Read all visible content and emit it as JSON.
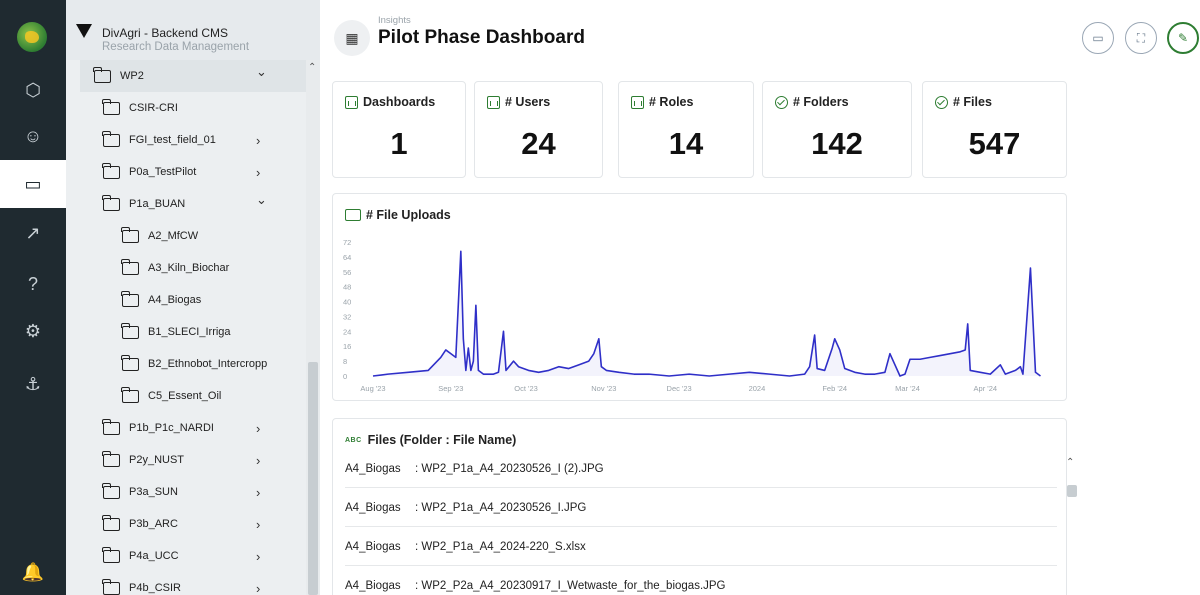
{
  "rail": {
    "items": [
      {
        "icon": "cube-icon",
        "glyph": "⬡",
        "active": false
      },
      {
        "icon": "users-icon",
        "glyph": "☺",
        "active": false
      },
      {
        "icon": "folder-icon",
        "glyph": "▭",
        "active": true
      },
      {
        "icon": "trend-icon",
        "glyph": "↗",
        "active": false
      },
      {
        "icon": "help-icon",
        "glyph": "?",
        "active": false
      },
      {
        "icon": "gear-icon",
        "glyph": "⚙",
        "active": false
      },
      {
        "icon": "anchor-icon",
        "glyph": "⚓",
        "active": false
      },
      {
        "icon": "bell-icon",
        "glyph": "🔔",
        "active": false
      }
    ]
  },
  "sidebar": {
    "title": "DivAgri - Backend CMS",
    "subtitle": "Research Data Management",
    "items": [
      {
        "label": "WP2",
        "level": 0,
        "chevron": "down",
        "selected": true
      },
      {
        "label": "CSIR-CRI",
        "level": 1,
        "chevron": ""
      },
      {
        "label": "FGI_test_field_01",
        "level": 1,
        "chevron": "right"
      },
      {
        "label": "P0a_TestPilot",
        "level": 1,
        "chevron": "right"
      },
      {
        "label": "P1a_BUAN",
        "level": 1,
        "chevron": "down"
      },
      {
        "label": "A2_MfCW",
        "level": 2,
        "chevron": ""
      },
      {
        "label": "A3_Kiln_Biochar",
        "level": 2,
        "chevron": ""
      },
      {
        "label": "A4_Biogas",
        "level": 2,
        "chevron": ""
      },
      {
        "label": "B1_SLECI_Irriga",
        "level": 2,
        "chevron": ""
      },
      {
        "label": "B2_Ethnobot_Intercropp",
        "level": 2,
        "chevron": ""
      },
      {
        "label": "C5_Essent_Oil",
        "level": 2,
        "chevron": ""
      },
      {
        "label": "P1b_P1c_NARDI",
        "level": 1,
        "chevron": "right"
      },
      {
        "label": "P2y_NUST",
        "level": 1,
        "chevron": "right"
      },
      {
        "label": "P3a_SUN",
        "level": 1,
        "chevron": "right"
      },
      {
        "label": "P3b_ARC",
        "level": 1,
        "chevron": "right"
      },
      {
        "label": "P4a_UCC",
        "level": 1,
        "chevron": "right"
      },
      {
        "label": "P4b_CSIR",
        "level": 1,
        "chevron": "right"
      }
    ]
  },
  "header": {
    "breadcrumb": "Insights",
    "title": "Pilot Phase Dashboard"
  },
  "kpis": [
    {
      "label": "Dashboards",
      "value": "1",
      "icon": "bar-chart-icon"
    },
    {
      "label": "# Users",
      "value": "24",
      "icon": "bar-chart-icon"
    },
    {
      "label": "# Roles",
      "value": "14",
      "icon": "bar-chart-icon"
    },
    {
      "label": "# Folders",
      "value": "142",
      "icon": "check-circle-icon"
    },
    {
      "label": "# Files",
      "value": "547",
      "icon": "check-circle-icon"
    }
  ],
  "uploads": {
    "title": "# File Uploads"
  },
  "chart_data": {
    "type": "line",
    "title": "# File Uploads",
    "ylim": [
      0,
      72
    ],
    "y_ticks": [
      0,
      8,
      16,
      24,
      32,
      40,
      48,
      56,
      64,
      72
    ],
    "x_ticks": [
      {
        "label": "Aug '23",
        "x": 0
      },
      {
        "label": "Sep '23",
        "x": 31
      },
      {
        "label": "Oct '23",
        "x": 61
      },
      {
        "label": "Nov '23",
        "x": 92
      },
      {
        "label": "Dec '23",
        "x": 122
      },
      {
        "label": "2024",
        "x": 153
      },
      {
        "label": "Feb '24",
        "x": 184
      },
      {
        "label": "Mar '24",
        "x": 213
      },
      {
        "label": "Apr '24",
        "x": 244
      }
    ],
    "x_max": 267,
    "color": "#2f2fc8",
    "points": [
      [
        0,
        0
      ],
      [
        6,
        1
      ],
      [
        14,
        2
      ],
      [
        22,
        3
      ],
      [
        27,
        10
      ],
      [
        29,
        14
      ],
      [
        31,
        12
      ],
      [
        33,
        10
      ],
      [
        35,
        67
      ],
      [
        36,
        20
      ],
      [
        37,
        3
      ],
      [
        38,
        15
      ],
      [
        39,
        3
      ],
      [
        40,
        8
      ],
      [
        41,
        38
      ],
      [
        42,
        3
      ],
      [
        44,
        1
      ],
      [
        48,
        1
      ],
      [
        50,
        2
      ],
      [
        52,
        24
      ],
      [
        53,
        3
      ],
      [
        56,
        8
      ],
      [
        58,
        5
      ],
      [
        62,
        3
      ],
      [
        66,
        2
      ],
      [
        70,
        3
      ],
      [
        74,
        5
      ],
      [
        78,
        4
      ],
      [
        82,
        6
      ],
      [
        86,
        8
      ],
      [
        88,
        12
      ],
      [
        90,
        20
      ],
      [
        91,
        5
      ],
      [
        93,
        3
      ],
      [
        98,
        2
      ],
      [
        104,
        1
      ],
      [
        110,
        1
      ],
      [
        118,
        0
      ],
      [
        126,
        1
      ],
      [
        134,
        0
      ],
      [
        142,
        1
      ],
      [
        150,
        2
      ],
      [
        158,
        1
      ],
      [
        166,
        0
      ],
      [
        172,
        1
      ],
      [
        174,
        5
      ],
      [
        176,
        22
      ],
      [
        177,
        4
      ],
      [
        180,
        3
      ],
      [
        183,
        15
      ],
      [
        184,
        20
      ],
      [
        186,
        14
      ],
      [
        188,
        4
      ],
      [
        192,
        2
      ],
      [
        196,
        1
      ],
      [
        200,
        1
      ],
      [
        204,
        2
      ],
      [
        206,
        12
      ],
      [
        208,
        6
      ],
      [
        210,
        0
      ],
      [
        212,
        1
      ],
      [
        214,
        9
      ],
      [
        218,
        9
      ],
      [
        222,
        10
      ],
      [
        226,
        11
      ],
      [
        230,
        12
      ],
      [
        234,
        13
      ],
      [
        236,
        14
      ],
      [
        237,
        28
      ],
      [
        238,
        3
      ],
      [
        242,
        2
      ],
      [
        246,
        1
      ],
      [
        250,
        6
      ],
      [
        252,
        1
      ],
      [
        254,
        2
      ],
      [
        256,
        3
      ],
      [
        258,
        5
      ],
      [
        259,
        1
      ],
      [
        262,
        58
      ],
      [
        264,
        2
      ],
      [
        266,
        0
      ]
    ]
  },
  "files": {
    "title": "Files (Folder : File Name)",
    "badge": "ABC",
    "rows": [
      {
        "folder": "A4_Biogas",
        "name": ": WP2_P1a_A4_20230526_I (2).JPG"
      },
      {
        "folder": "A4_Biogas",
        "name": ": WP2_P1a_A4_20230526_I.JPG"
      },
      {
        "folder": "A4_Biogas",
        "name": ": WP2_P1a_A4_2024-220_S.xlsx"
      },
      {
        "folder": "A4_Biogas",
        "name": ": WP2_P2a_A4_20230917_I_Wetwaste_for_the_biogas.JPG"
      }
    ]
  },
  "colors": {
    "rail_bg": "#1f2a30",
    "accent": "#2e7d32",
    "line": "#2f2fc8"
  }
}
